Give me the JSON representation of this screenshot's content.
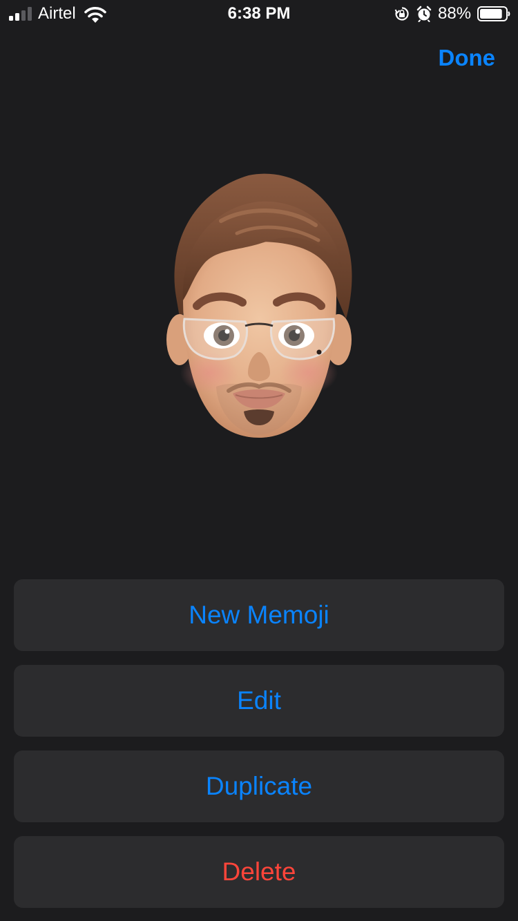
{
  "status_bar": {
    "carrier": "Airtel",
    "time": "6:38 PM",
    "battery_percent": "88%",
    "battery_level": 0.88,
    "signal_bars_active": 2,
    "signal_bars_total": 4,
    "icons": [
      "signal-icon",
      "wifi-icon",
      "orientation-lock-icon",
      "alarm-icon",
      "battery-icon"
    ]
  },
  "nav": {
    "done_label": "Done"
  },
  "memoji": {
    "icon": "memoji-avatar"
  },
  "actions": {
    "new_memoji_label": "New Memoji",
    "edit_label": "Edit",
    "duplicate_label": "Duplicate",
    "delete_label": "Delete"
  },
  "colors": {
    "background": "#1c1c1e",
    "button_background": "#2c2c2e",
    "accent": "#0a84ff",
    "destructive": "#ff453a"
  }
}
